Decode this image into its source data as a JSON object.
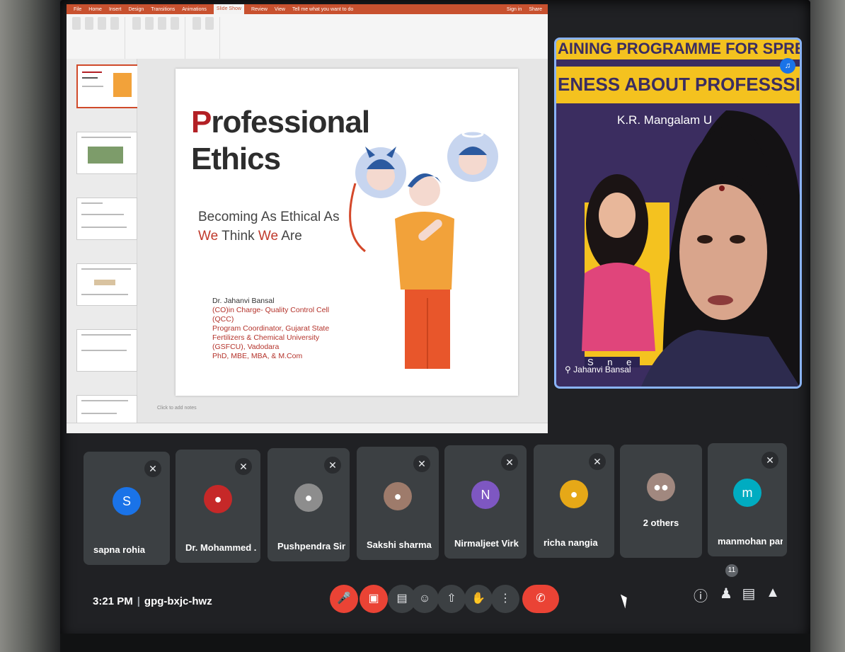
{
  "ppt": {
    "titlebar_tabs": [
      "File",
      "Home",
      "Insert",
      "Design",
      "Transitions",
      "Animations",
      "Slide Show",
      "Review",
      "View"
    ],
    "tell_me": "Tell me what you want to do",
    "sign_in": "Sign in",
    "share": "Share",
    "notes_placeholder": "Click to add notes"
  },
  "slide": {
    "title_first_letter": "P",
    "title_rest_line1": "rofessional",
    "title_line2": "Ethics",
    "subtitle_part1": "Becoming As Ethical As ",
    "subtitle_we1": "We",
    "subtitle_part2": "Think ",
    "subtitle_we2": "We",
    "subtitle_part3": " Are",
    "author_name": "Dr. Jahanvi Bansal",
    "author_lines": [
      "(CO)in Charge- Quality Control Cell",
      "(QCC)",
      "Program Coordinator, Gujarat State",
      "Fertilizers & Chemical University",
      "(GSFCU), Vadodara",
      "PhD, MBE, MBA, & M.Com"
    ]
  },
  "speaker": {
    "banner_line1": "AINING PROGRAMME FOR SPREAD",
    "banner_line2": "ENESS ABOUT PROFESSSIONAL ET",
    "institution": "K.R. Mangalam U",
    "overlay_text": "S n e",
    "name": "Jahanvi Bansal"
  },
  "participants": [
    {
      "name": "sapna rohia",
      "initial": "S",
      "color": "#1a73e8"
    },
    {
      "name": "Dr. Mohammed ...",
      "initial": "",
      "color": "#c62828"
    },
    {
      "name": "Pushpendra Singh",
      "initial": "",
      "color": "#8d8d8d"
    },
    {
      "name": "Sakshi sharma",
      "initial": "",
      "color": "#9e7b6b"
    },
    {
      "name": "Nirmaljeet Virk",
      "initial": "N",
      "color": "#7e57c2"
    },
    {
      "name": "richa nangia",
      "initial": "",
      "color": "#e6a817"
    },
    {
      "name": "2 others",
      "initial": "",
      "color": "#a1887f"
    },
    {
      "name": "manmohan para...",
      "initial": "m",
      "color": "#00acc1"
    }
  ],
  "meeting": {
    "time": "3:21 PM",
    "separator": "|",
    "code": "gpg-bxjc-hwz",
    "participant_count": "11"
  },
  "controls": {
    "mic_icon": "mic-off-icon",
    "cam_icon": "camera-off-icon",
    "captions_icon": "captions-icon",
    "emoji_icon": "emoji-icon",
    "present_icon": "present-icon",
    "hand_icon": "raise-hand-icon",
    "more_icon": "more-icon",
    "leave_icon": "leave-call-icon"
  },
  "colors": {
    "accent": "#1a73e8",
    "danger": "#ea4335",
    "tile": "#3c4043",
    "ppt_brand": "#c8512f",
    "slide_red": "#b32025"
  }
}
